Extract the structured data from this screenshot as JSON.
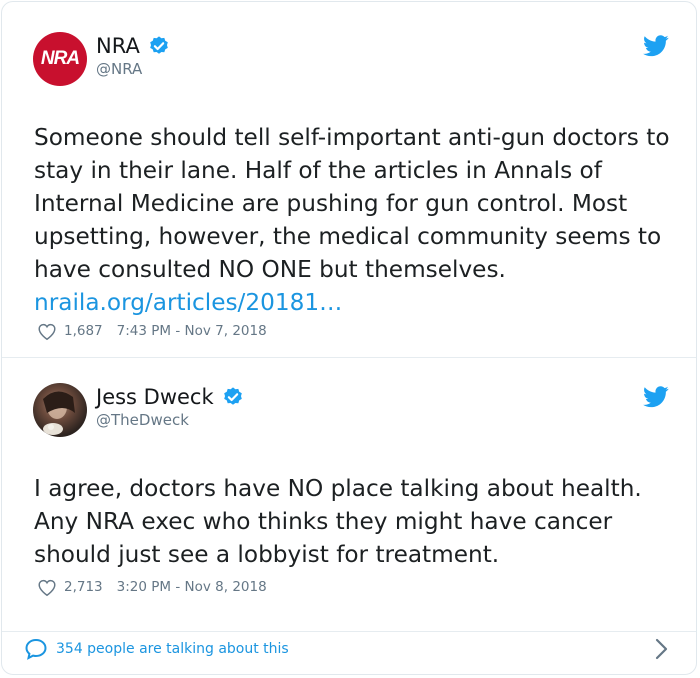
{
  "colors": {
    "accent": "#1da1f2",
    "link": "#1b95e0",
    "muted": "#657786",
    "nra_red": "#c8102e"
  },
  "tweets": [
    {
      "avatar_text": "NRA",
      "name": "NRA",
      "handle": "@NRA",
      "verified": true,
      "text": "Someone should tell self-important  anti-gun doctors to stay in their lane. Half of the articles in Annals of Internal Medicine are pushing for gun control. Most upsetting, however, the medical community seems to have consulted NO ONE but themselves.",
      "link": "nraila.org/articles/20181…",
      "likes": "1,687",
      "timestamp": "7:43 PM - Nov 7, 2018"
    },
    {
      "name": "Jess Dweck",
      "handle": "@TheDweck",
      "verified": true,
      "text": "I agree, doctors have NO place talking about health. Any NRA exec who thinks they might have cancer should just see a lobbyist for treatment.",
      "likes": "2,713",
      "timestamp": "3:20 PM - Nov 8, 2018"
    }
  ],
  "footer": {
    "talking": "354 people are talking about this"
  },
  "icons": [
    "verified-badge-icon",
    "twitter-bird-icon",
    "heart-icon",
    "speech-bubble-icon",
    "chevron-right-icon"
  ]
}
